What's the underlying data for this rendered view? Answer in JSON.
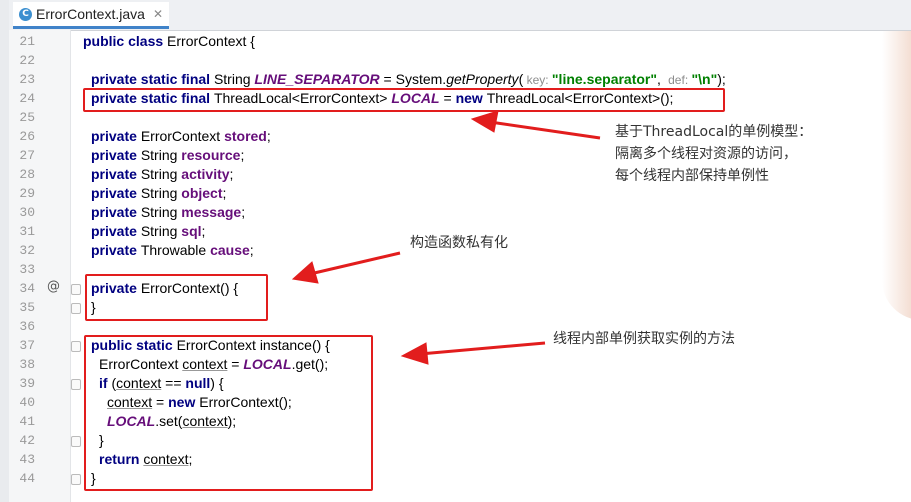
{
  "tab": {
    "title": "ErrorContext.java",
    "icon": "class-icon"
  },
  "lines": [
    {
      "n": "21"
    },
    {
      "n": "22"
    },
    {
      "n": "23"
    },
    {
      "n": "24"
    },
    {
      "n": "25"
    },
    {
      "n": "26"
    },
    {
      "n": "27"
    },
    {
      "n": "28"
    },
    {
      "n": "29"
    },
    {
      "n": "30"
    },
    {
      "n": "31"
    },
    {
      "n": "32"
    },
    {
      "n": "33"
    },
    {
      "n": "34"
    },
    {
      "n": "35"
    },
    {
      "n": "36"
    },
    {
      "n": "37"
    },
    {
      "n": "38"
    },
    {
      "n": "39"
    },
    {
      "n": "40"
    },
    {
      "n": "41"
    },
    {
      "n": "42"
    },
    {
      "n": "43"
    },
    {
      "n": "44"
    }
  ],
  "code": {
    "l21": {
      "kw": "public class ",
      "rest": "ErrorContext {"
    },
    "l23": {
      "kw": "private static final ",
      "type": "String ",
      "const": "LINE_SEPARATOR",
      "eq": " = System.",
      "method": "getProperty",
      "open": "(",
      "hint1": " key: ",
      "str1": "\"line.separator\"",
      "comma": ", ",
      "hint2": " def: ",
      "str2": "\"\\n\"",
      "close": ");"
    },
    "l24": {
      "kw": "private static final ",
      "type": "ThreadLocal<ErrorContext> ",
      "const": "LOCAL",
      "eq": " = ",
      "kw2": "new ",
      "rest": "ThreadLocal<ErrorContext>();"
    },
    "l26": {
      "kw": "private ",
      "type": "ErrorContext ",
      "field": "stored",
      "end": ";"
    },
    "l27": {
      "kw": "private ",
      "type": "String ",
      "field": "resource",
      "end": ";"
    },
    "l28": {
      "kw": "private ",
      "type": "String ",
      "field": "activity",
      "end": ";"
    },
    "l29": {
      "kw": "private ",
      "type": "String ",
      "field": "object",
      "end": ";"
    },
    "l30": {
      "kw": "private ",
      "type": "String ",
      "field": "message",
      "end": ";"
    },
    "l31": {
      "kw": "private ",
      "type": "String ",
      "field": "sql",
      "end": ";"
    },
    "l32": {
      "kw": "private ",
      "type": "Throwable ",
      "field": "cause",
      "end": ";"
    },
    "l34": {
      "kw": "private ",
      "rest": "ErrorContext() {"
    },
    "l35": {
      "rest": "}"
    },
    "l37": {
      "kw": "public static ",
      "rest": "ErrorContext instance() {"
    },
    "l38": {
      "type": "ErrorContext ",
      "var": "context",
      "eq": " = ",
      "const": "LOCAL",
      "rest": ".get();"
    },
    "l39": {
      "kw": "if ",
      "open": "(",
      "var": "context",
      "mid": " == ",
      "kw2": "null",
      "rest": ") {"
    },
    "l40": {
      "var": "context",
      "eq": " = ",
      "kw": "new ",
      "rest": "ErrorContext();"
    },
    "l41": {
      "const": "LOCAL",
      "mid": ".set(",
      "var": "context",
      "rest": ");"
    },
    "l42": {
      "rest": "}"
    },
    "l43": {
      "kw": "return ",
      "var": "context",
      "rest": ";"
    },
    "l44": {
      "rest": "}"
    }
  },
  "annotations": {
    "a1": "基于ThreadLocal的单例模型：\n隔离多个线程对资源的访问，\n每个线程内部保持单例性",
    "a2": "构造函数私有化",
    "a3": "线程内部单例获取实例的方法"
  },
  "gutter": {
    "override_marker": "@"
  },
  "colors": {
    "keyword": "#000080",
    "field": "#660e7a",
    "string": "#008000",
    "highlight_box": "#e21d1d",
    "tab_accent": "#4083c9"
  }
}
